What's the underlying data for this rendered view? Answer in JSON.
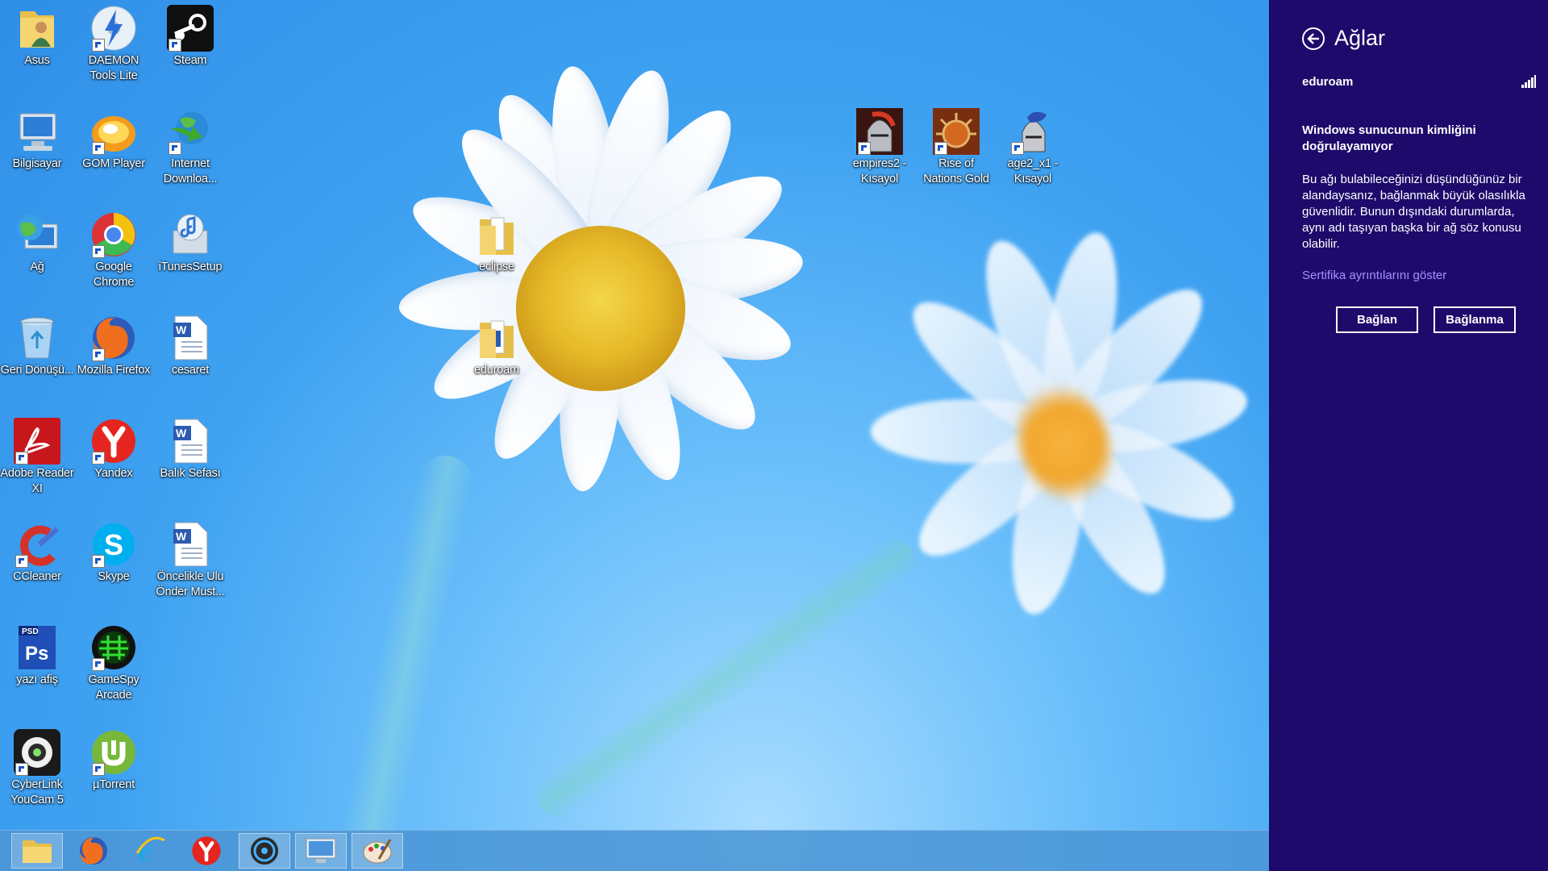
{
  "desktop": {
    "icons": [
      {
        "label": "Asus"
      },
      {
        "label": "DAEMON Tools Lite"
      },
      {
        "label": "Steam"
      },
      {
        "label": "Bilgisayar"
      },
      {
        "label": "GOM Player"
      },
      {
        "label": "Internet Downloa..."
      },
      {
        "label": "Ağ"
      },
      {
        "label": "Google Chrome"
      },
      {
        "label": "iTunesSetup"
      },
      {
        "label": "Geri Dönüşü..."
      },
      {
        "label": "Mozilla Firefox"
      },
      {
        "label": "cesaret"
      },
      {
        "label": "Adobe Reader XI"
      },
      {
        "label": "Yandex"
      },
      {
        "label": "Balık Sefası"
      },
      {
        "label": "CCleaner"
      },
      {
        "label": "Skype"
      },
      {
        "label": "Öncelikle Ulu Önder Must..."
      },
      {
        "label": "yazı afiş"
      },
      {
        "label": "GameSpy Arcade"
      },
      {
        "label": "CyberLink YouCam 5"
      },
      {
        "label": "µTorrent"
      },
      {
        "label": "eclipse"
      },
      {
        "label": "eduroam"
      },
      {
        "label": "empires2 - Kısayol"
      },
      {
        "label": "Rise of Nations Gold"
      },
      {
        "label": "age2_x1 - Kısayol"
      }
    ]
  },
  "taskbar": {
    "items": [
      "file-explorer",
      "firefox",
      "internet-explorer",
      "yandex",
      "media-app",
      "remote-desktop",
      "paint"
    ]
  },
  "charm": {
    "title": "Ağlar",
    "network_name": "eduroam",
    "warning": "Windows sunucunun kimliğini doğrulayamıyor",
    "description": "Bu ağı bulabileceğinizi düşündüğünüz bir alandaysanız, bağlanmak büyük olasılıkla güvenlidir. Bunun dışındaki durumlarda, aynı adı taşıyan başka bir ağ söz konusu olabilir.",
    "cert_link": "Sertifika ayrıntılarını göster",
    "connect_label": "Bağlan",
    "dont_connect_label": "Bağlanma",
    "colors": {
      "panel": "#1d0a6b",
      "link": "#a592ff"
    }
  }
}
